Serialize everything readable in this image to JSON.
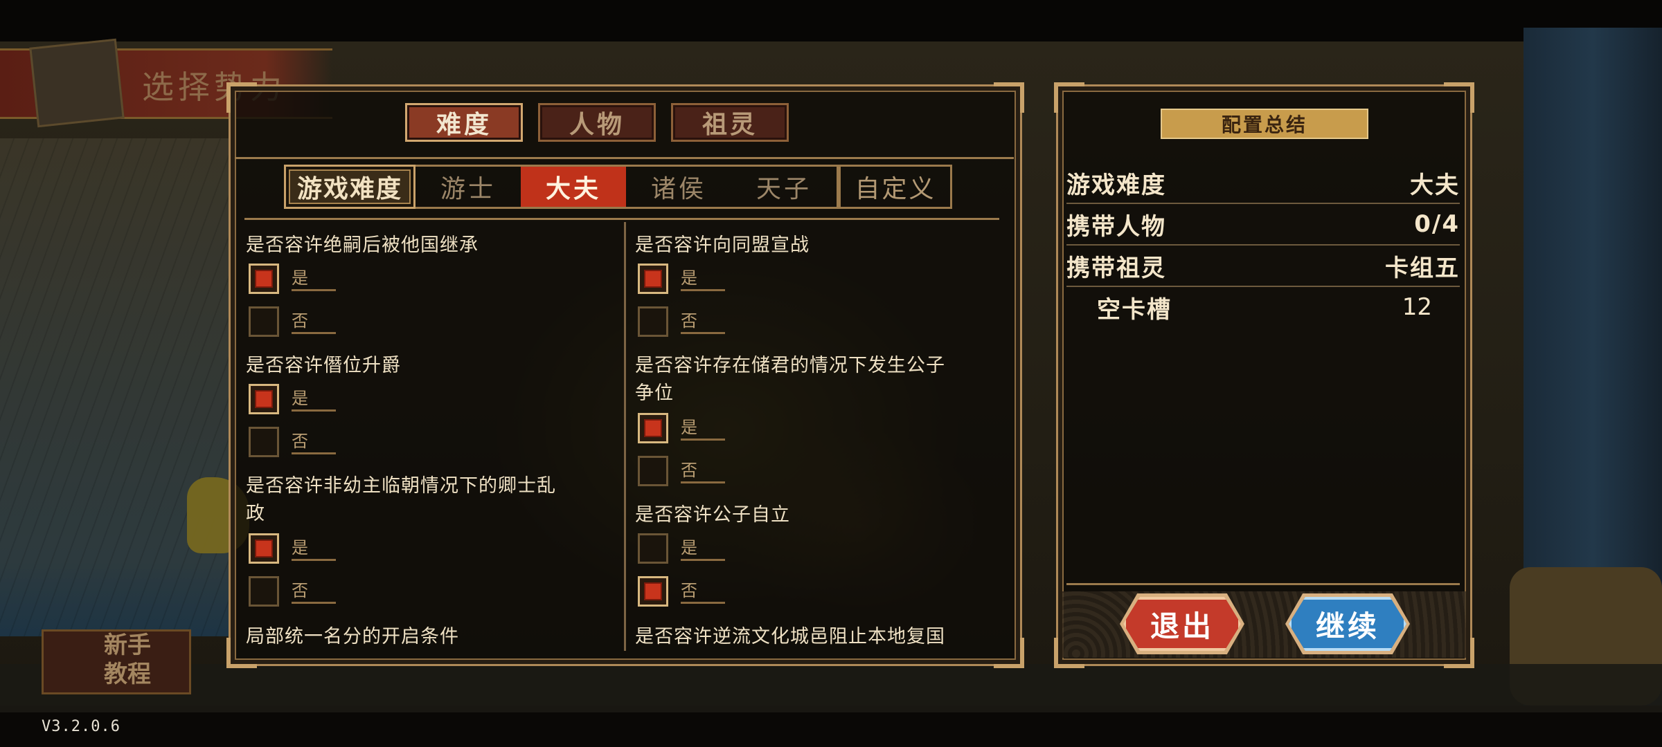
{
  "background": {
    "title": "选择势力",
    "tutorial_line1": "新手",
    "tutorial_line2": "教程"
  },
  "top_tabs": [
    {
      "label": "难度",
      "active": true
    },
    {
      "label": "人物",
      "active": false
    },
    {
      "label": "祖灵",
      "active": false
    }
  ],
  "difficulty": {
    "label": "游戏难度",
    "options": [
      {
        "label": "游士",
        "active": false
      },
      {
        "label": "大夫",
        "active": true
      },
      {
        "label": "诸侯",
        "active": false
      },
      {
        "label": "天子",
        "active": false
      }
    ],
    "custom": "自定义"
  },
  "settings": {
    "left": [
      {
        "question": "是否容许绝嗣后被他国继承",
        "yes": "是",
        "no": "否",
        "selected": "yes"
      },
      {
        "question": "是否容许僭位升爵",
        "yes": "是",
        "no": "否",
        "selected": "yes"
      },
      {
        "question_line1": "是否容许非幼主临朝情况下的卿士乱",
        "question_line2": "政",
        "yes": "是",
        "no": "否",
        "selected": "yes"
      },
      {
        "question": "局部统一名分的开启条件"
      }
    ],
    "right": [
      {
        "question": "是否容许向同盟宣战",
        "yes": "是",
        "no": "否",
        "selected": "yes"
      },
      {
        "question_line1": "是否容许存在储君的情况下发生公子",
        "question_line2": "争位",
        "yes": "是",
        "no": "否",
        "selected": "yes"
      },
      {
        "question": "是否容许公子自立",
        "yes": "是",
        "no": "否",
        "selected": "no"
      },
      {
        "question": "是否容许逆流文化城邑阻止本地复国"
      }
    ]
  },
  "summary": {
    "title": "配置总结",
    "rows": [
      {
        "label": "游戏难度",
        "value": "大夫"
      },
      {
        "label": "携带人物",
        "value": "0/4"
      },
      {
        "label": "携带祖灵",
        "value": "卡组五"
      },
      {
        "label": "空卡槽",
        "value": "12"
      }
    ],
    "exit": "退出",
    "continue": "继续"
  },
  "version": "V3.2.0.6",
  "colors": {
    "accent_gold": "#c9a26a",
    "selected_red": "#c0321a",
    "exit_red": "#c43a2a",
    "continue_blue": "#2f7fc0"
  }
}
